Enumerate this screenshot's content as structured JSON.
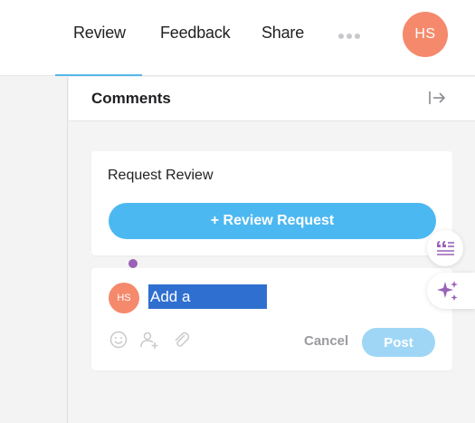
{
  "topbar": {
    "tabs": [
      {
        "label": "Review",
        "active": true
      },
      {
        "label": "Feedback",
        "active": false
      },
      {
        "label": "Share",
        "active": false
      }
    ],
    "more_icon": "more-dots-icon",
    "user_initials": "HS"
  },
  "comments_panel": {
    "title": "Comments",
    "collapse_icon": "collapse-right-icon",
    "request_review": {
      "heading": "Request Review",
      "button_label": "+ Review Request"
    },
    "composer": {
      "user_initials": "HS",
      "placeholder": "Add a comment...",
      "tools": [
        "emoji-icon",
        "mention-user-icon",
        "attachment-icon"
      ],
      "cancel_label": "Cancel",
      "post_label": "Post"
    }
  },
  "floating_actions": [
    "quote-list-icon",
    "sparkles-icon"
  ],
  "colors": {
    "accent": "#4cb8f1",
    "avatar": "#f5896c",
    "tab_underline": "#56b6ea",
    "purple": "#9a62b7",
    "selection": "#2f6fd0"
  }
}
